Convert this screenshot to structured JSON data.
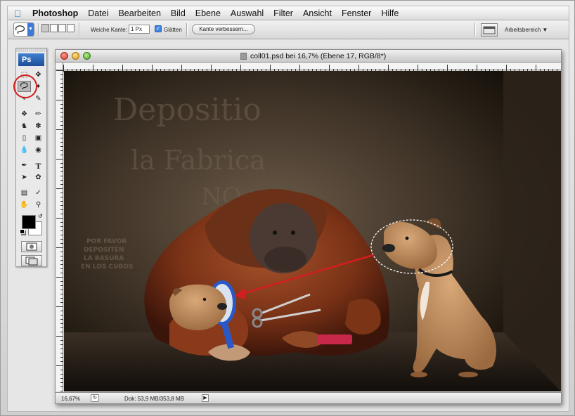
{
  "menubar": {
    "app_name": "Photoshop",
    "items": [
      "Datei",
      "Bearbeiten",
      "Bild",
      "Ebene",
      "Auswahl",
      "Filter",
      "Ansicht",
      "Fenster",
      "Hilfe"
    ]
  },
  "options": {
    "feather_label": "Weiche Kante:",
    "feather_value": "1 Px",
    "antialias_label": "Glätten",
    "antialias_checked": true,
    "refine_edge_label": "Kante verbessern...",
    "workspace_label": "Arbeitsbereich ▼"
  },
  "toolbox": {
    "logo": "Ps",
    "active_tool": "lasso-tool"
  },
  "document": {
    "title": "coll01.psd bei 16,7% (Ebene 17, RGB/8*)"
  },
  "canvas_art": {
    "wall_text_large": [
      "Depositio",
      "la Fabrica",
      "NO"
    ],
    "wall_text_small": [
      "POR FAVOR",
      "DEPOSITEN",
      "LA BASURA",
      "EN LOS CUBOS"
    ]
  },
  "statusbar": {
    "zoom": "16,67%",
    "doc_info": "Dok: 53,9 MB/353,8 MB"
  },
  "colors": {
    "annotation_red": "#d21e1e",
    "selection_ants": "#ffffff",
    "accent_blue": "#3d79d9"
  }
}
